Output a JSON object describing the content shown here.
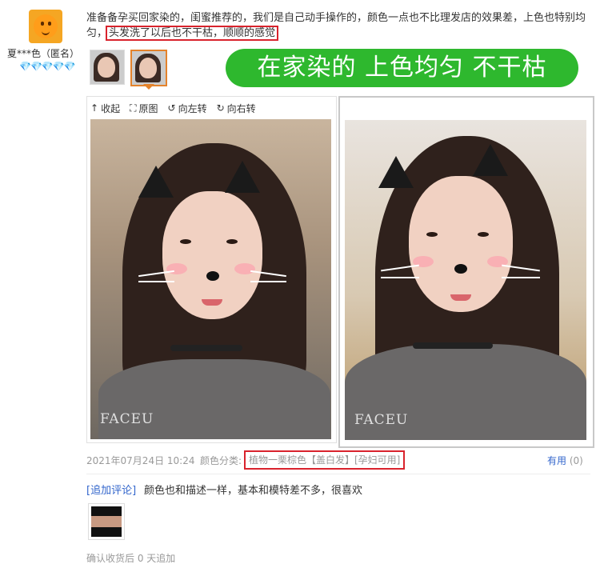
{
  "user": {
    "name": "夏***色（匿名）",
    "level_gems": "💎💎💎💎💎"
  },
  "review": {
    "text_part1": "准备备孕买回家染的，闺蜜推荐的，我们是自己动手操作的，颜色一点也不比理发店的效果差，上色也特别均匀，",
    "text_highlight": "头发洗了以后也不干枯，顺顺的感觉",
    "banner": "在家染的 上色均匀 不干枯"
  },
  "viewer": {
    "collapse_label": "收起",
    "original_label": "原图",
    "rotate_left_label": "向左转",
    "rotate_right_label": "向右转",
    "watermark": "FACEU"
  },
  "meta": {
    "date": "2021年07月24日 10:24",
    "color_label": "颜色分类:",
    "color_value": "植物一栗棕色【盖白发】[孕妇可用]",
    "useful_label": "有用",
    "useful_count": "(0)"
  },
  "append": {
    "tag": "[追加评论]",
    "text": "颜色也和描述一样，基本和模特差不多，很喜欢"
  },
  "footer": {
    "note": "确认收货后 0 天追加"
  },
  "colors": {
    "banner_green": "#2eb82e",
    "highlight_red": "#d9232d",
    "link_blue": "#3366cc",
    "active_orange": "#e4832c"
  }
}
